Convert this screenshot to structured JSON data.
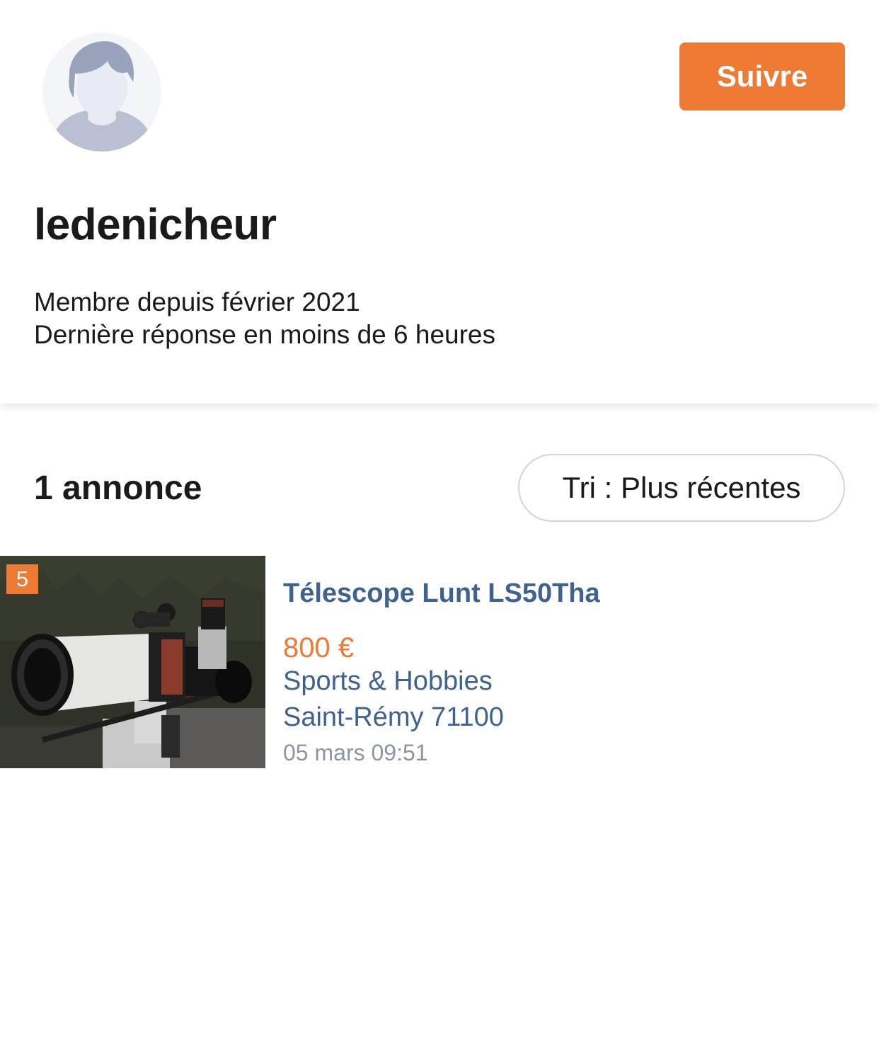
{
  "profile": {
    "username": "ledenicheur",
    "member_since": "Membre depuis février 2021",
    "last_response": "Dernière réponse en moins de 6 heures",
    "follow_label": "Suivre",
    "avatar_icon": "default-user-avatar-icon"
  },
  "listings_header": {
    "count_label": "1 annonce",
    "sort_label": "Tri : Plus récentes"
  },
  "listings": [
    {
      "photo_count": "5",
      "title": "Télescope Lunt LS50Tha",
      "price": "800 €",
      "category": "Sports & Hobbies",
      "location": "Saint-Rémy 71100",
      "date": "05 mars 09:51"
    }
  ],
  "colors": {
    "accent": "#ee7a33",
    "link": "#3f6291",
    "muted": "#8c96a2"
  }
}
